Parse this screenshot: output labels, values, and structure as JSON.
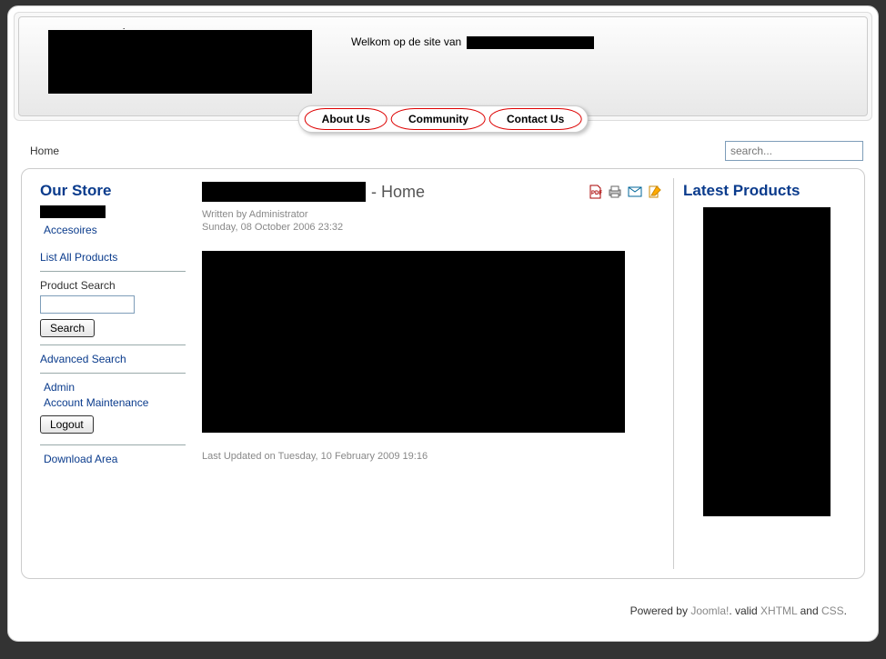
{
  "header": {
    "welcome_text": "Welkom op de site van "
  },
  "nav": {
    "about": "About Us",
    "community": "Community",
    "contact": "Contact Us"
  },
  "breadcrumb": "Home",
  "search": {
    "placeholder": "search..."
  },
  "store": {
    "title": "Our Store",
    "accesoires": "Accesoires",
    "list_all": "List All Products",
    "product_search_label": "Product Search",
    "search_btn": "Search",
    "advanced": "Advanced Search",
    "admin": "Admin",
    "account_maint": "Account Maintenance",
    "logout": "Logout",
    "download": "Download Area"
  },
  "article": {
    "title_suffix": " - Home",
    "written_by": "Written by Administrator",
    "date": "Sunday, 08 October 2006 23:32",
    "last_updated": "Last Updated on Tuesday, 10 February 2009 19:16"
  },
  "right": {
    "title": "Latest Products"
  },
  "footer": {
    "powered": "Powered by ",
    "joomla": "Joomla!",
    "valid": ". valid ",
    "xhtml": "XHTML",
    "and": " and ",
    "css": "CSS",
    "dot": "."
  }
}
